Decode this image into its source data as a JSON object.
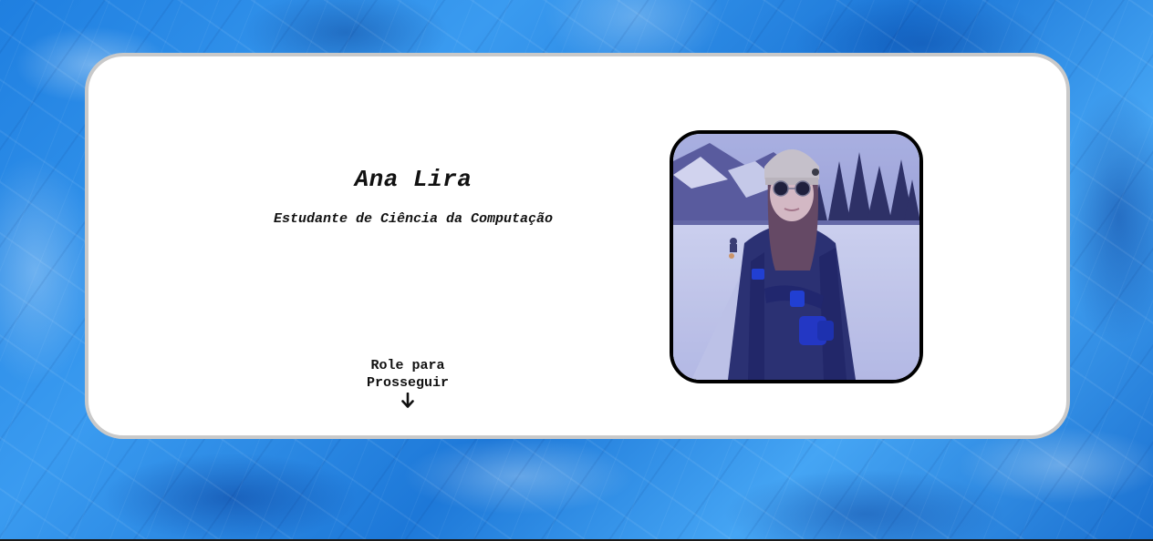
{
  "hero": {
    "name": "Ana Lira",
    "subtitle": "Estudante de Ciência da Computação",
    "scroll_hint_line1": "Role para",
    "scroll_hint_line2": "Prosseguir",
    "scroll_icon": "arrow-down-icon"
  },
  "profile_photo": {
    "description_icon": "profile-photo"
  },
  "colors": {
    "background": "#2f8fe6",
    "card": "#ffffff",
    "card_border": "#c9c9c9",
    "text": "#111111",
    "photo_border": "#000000"
  }
}
